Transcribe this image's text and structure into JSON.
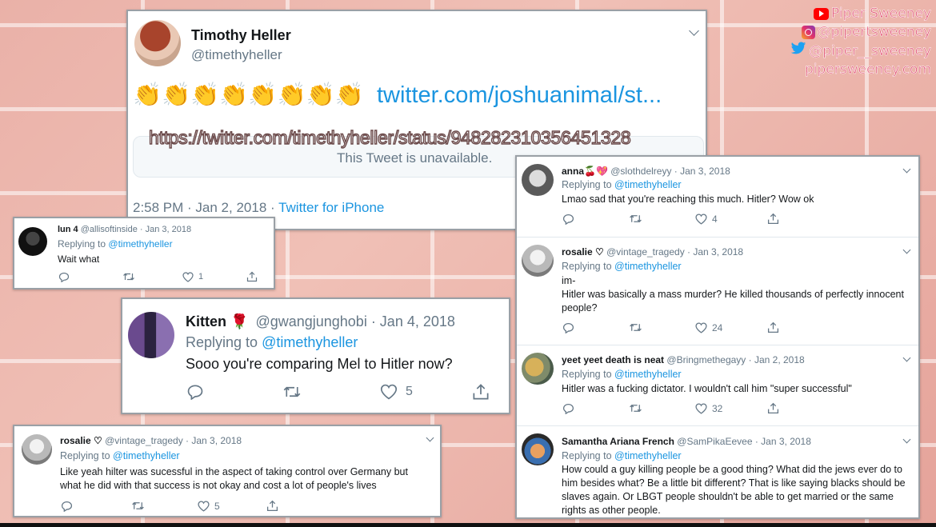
{
  "main_tweet": {
    "name": "Timothy Heller",
    "handle": "@timethyheller",
    "clap_emojis": "👏👏👏👏👏👏👏👏",
    "link": "twitter.com/joshuanimal/st...",
    "unavailable": "This Tweet is unavailable.",
    "timestamp": "2:58 PM · Jan 2, 2018 · ",
    "client": "Twitter for iPhone"
  },
  "url_overlay": "https://twitter.com/timethyheller/status/948282310356451328",
  "watermark": {
    "youtube": "Piper Sweeney",
    "instagram": "@pipertsweeney",
    "twitter": "@piper__sweeney",
    "site": "pipersweeney.com",
    "colors": {
      "youtube": "#ff0000",
      "instagram": "#c13584",
      "twitter": "#1da1f2",
      "text": "#e35b7a"
    }
  },
  "replying_label": "Replying to",
  "replying_to": "@timethyheller",
  "replies": {
    "lun": {
      "name": "lun 4",
      "handle": "@allisoftinside · Jan 3, 2018",
      "text": "Wait what",
      "likes": "1"
    },
    "kitten": {
      "name": "Kitten 🌹",
      "handle": "@gwangjunghobi · Jan 4, 2018",
      "text": "Sooo you're comparing Mel to Hitler now?",
      "likes": "5"
    },
    "rosalie_left": {
      "name": "rosalie ♡",
      "handle": "@vintage_tragedy · Jan 3, 2018",
      "text1": "Like yeah hilter was sucessful in the aspect of taking control over Germany but",
      "text2": "what he did with that success is not okay and cost a lot of people's lives",
      "likes": "5"
    },
    "anna": {
      "name": "anna🍒💖",
      "handle": "@slothdelreyy · Jan 3, 2018",
      "text": "Lmao sad that you're reaching this much. Hitler? Wow ok",
      "likes": "4"
    },
    "rosalie_right": {
      "name": "rosalie ♡",
      "handle": "@vintage_tragedy · Jan 3, 2018",
      "text0": "im-",
      "text1": "Hitler was basically a mass murder? He killed thousands of perfectly innocent",
      "text2": "people?",
      "likes": "24"
    },
    "yeet": {
      "name": "yeet yeet death is neat",
      "handle": "@Bringmethegayy · Jan 2, 2018",
      "text": "Hitler was a fucking dictator. I wouldn't call him \"super successful\"",
      "likes": "32"
    },
    "samantha": {
      "name": "Samantha Ariana French",
      "handle": "@SamPikaEevee · Jan 3, 2018",
      "lines": [
        "How could a guy killing people be a good thing? What did the jews ever do to",
        "him besides what? Be a little bit different? That is like saying blacks should be",
        "slaves again. Or LBGT people shouldn't be able to get married or the same",
        "rights as other people."
      ]
    }
  }
}
